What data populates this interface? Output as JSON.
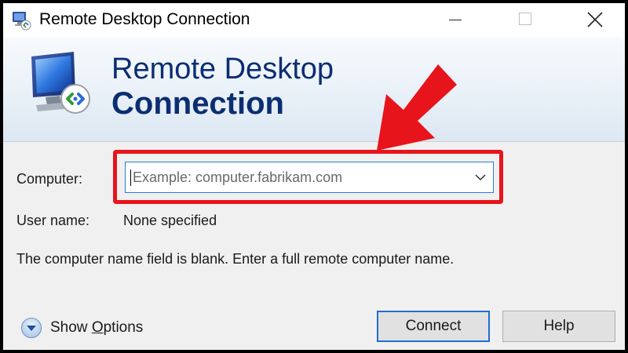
{
  "window": {
    "title": "Remote Desktop Connection",
    "controls": {
      "minimize_icon": "minimize-icon",
      "maximize_icon": "maximize-icon",
      "close_icon": "close-icon"
    }
  },
  "header": {
    "line1": "Remote Desktop",
    "line2": "Connection",
    "icon": "remote-desktop-monitor-icon"
  },
  "form": {
    "computer": {
      "label": "Computer:",
      "value": "",
      "placeholder": "Example: computer.fabrikam.com"
    },
    "username": {
      "label": "User name:",
      "value": "None specified"
    },
    "message": "The computer name field is blank. Enter a full remote computer name."
  },
  "footer": {
    "show_options_prefix": "Show ",
    "show_options_underlined": "O",
    "show_options_suffix": "ptions",
    "connect_label": "Connect",
    "help_label": "Help"
  },
  "annotation": {
    "highlight_color": "#e8141b",
    "arrow_icon": "red-arrow-icon"
  },
  "colors": {
    "header_text": "#0b2d72",
    "focus_border": "#2a7bd4"
  }
}
